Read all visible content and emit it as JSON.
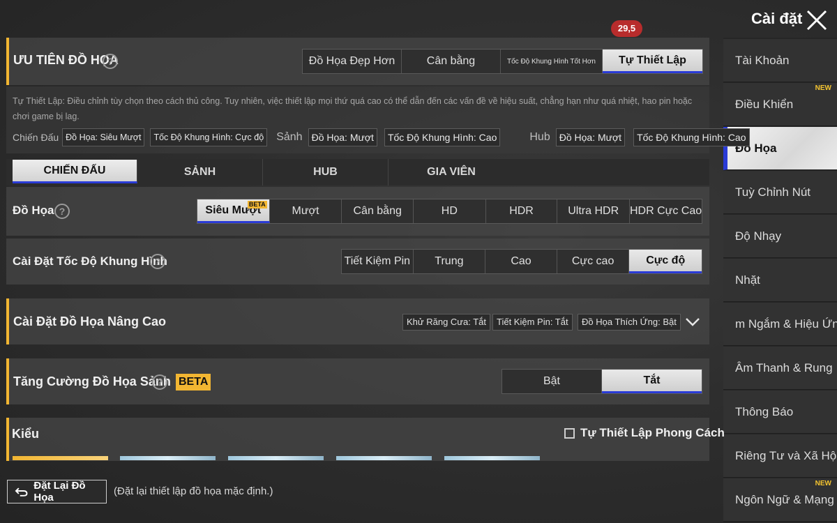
{
  "header": {
    "fps_badge": "29,5",
    "title": "Cài đặt"
  },
  "sidebar": {
    "items": [
      {
        "label": "Tài Khoản",
        "badge": ""
      },
      {
        "label": "Điều Khiển",
        "badge": "NEW"
      },
      {
        "label": "Đồ Họa",
        "badge": ""
      },
      {
        "label": "Tuỳ Chỉnh Nút",
        "badge": ""
      },
      {
        "label": "Độ Nhạy",
        "badge": ""
      },
      {
        "label": "Nhặt",
        "badge": ""
      },
      {
        "label": "m Ngắm & Hiệu Ứng",
        "badge": ""
      },
      {
        "label": "Âm Thanh & Rung",
        "badge": ""
      },
      {
        "label": "Thông Báo",
        "badge": ""
      },
      {
        "label": "Riêng Tư và Xã Hội",
        "badge": ""
      },
      {
        "label": "Ngôn Ngữ & Mạng",
        "badge": "NEW"
      }
    ],
    "active_item": "Đồ Họa"
  },
  "priority": {
    "title": "ƯU TIÊN ĐỒ HỌA",
    "options": [
      "Đồ Họa Đẹp Hơn",
      "Cân bằng",
      "Tốc Độ Khung Hình Tốt Hơn",
      "Tự Thiết Lập"
    ],
    "selected": "Tự Thiết Lập",
    "description": "Tự Thiết Lập: Điều chỉnh tùy chọn theo cách thủ công. Tuy nhiên, việc thiết lập mọi thứ quá cao có thể dẫn đến các vấn đề về hiệu suất, chẳng hạn như quá nhiệt, hao pin hoặc chơi game bị lag.",
    "summary": {
      "combat_label": "Chiến Đấu",
      "combat_graphics": "Đồ Họa: Siêu Mượt",
      "combat_fps": "Tốc Độ Khung Hình: Cực độ",
      "lobby_label": "Sảnh",
      "lobby_graphics": "Đồ Họa: Mượt",
      "lobby_fps": "Tốc Độ Khung Hình: Cao",
      "hub_label": "Hub",
      "hub_graphics": "Đồ Họa: Mượt",
      "hub_fps": "Tốc Độ Khung Hình: Cao"
    }
  },
  "mode_tabs": {
    "items": [
      "CHIẾN ĐẤU",
      "SẢNH",
      "HUB",
      "GIA VIÊN"
    ],
    "selected": "CHIẾN ĐẤU"
  },
  "graphics": {
    "label": "Đồ Họa",
    "options": [
      "Siêu Mượt",
      "Mượt",
      "Cân bằng",
      "HD",
      "HDR",
      "Ultra HDR",
      "HDR Cực Cao"
    ],
    "selected": "Siêu Mượt",
    "beta_tag": "BETA"
  },
  "framerate": {
    "label": "Cài Đặt Tốc Độ Khung Hình",
    "options": [
      "Tiết Kiệm Pin",
      "Trung",
      "Cao",
      "Cực cao",
      "Cực độ"
    ],
    "selected": "Cực độ"
  },
  "advanced": {
    "title": "Cài Đặt Đồ Họa Nâng Cao",
    "chips": [
      "Khử Răng Cưa: Tắt",
      "Tiết Kiệm Pin: Tắt",
      "Đồ Họa Thích Ứng: Bật"
    ]
  },
  "lobby_boost": {
    "label": "Tăng Cường Đồ Họa Sảnh",
    "beta": "BETA",
    "options": [
      "Bật",
      "Tắt"
    ],
    "selected": "Tắt"
  },
  "style": {
    "title": "Kiểu",
    "custom_style_label": "Tự Thiết Lập Phong Cách",
    "custom_style_checked": false
  },
  "footer": {
    "reset_label": "Đặt Lại Đồ Họa",
    "reset_note": "(Đặt lại thiết lập đồ họa mặc định.)"
  },
  "colors": {
    "accent": "#f2b632",
    "selection_underline": "#2a3bd6",
    "fps_badge": "#b82c2c"
  }
}
